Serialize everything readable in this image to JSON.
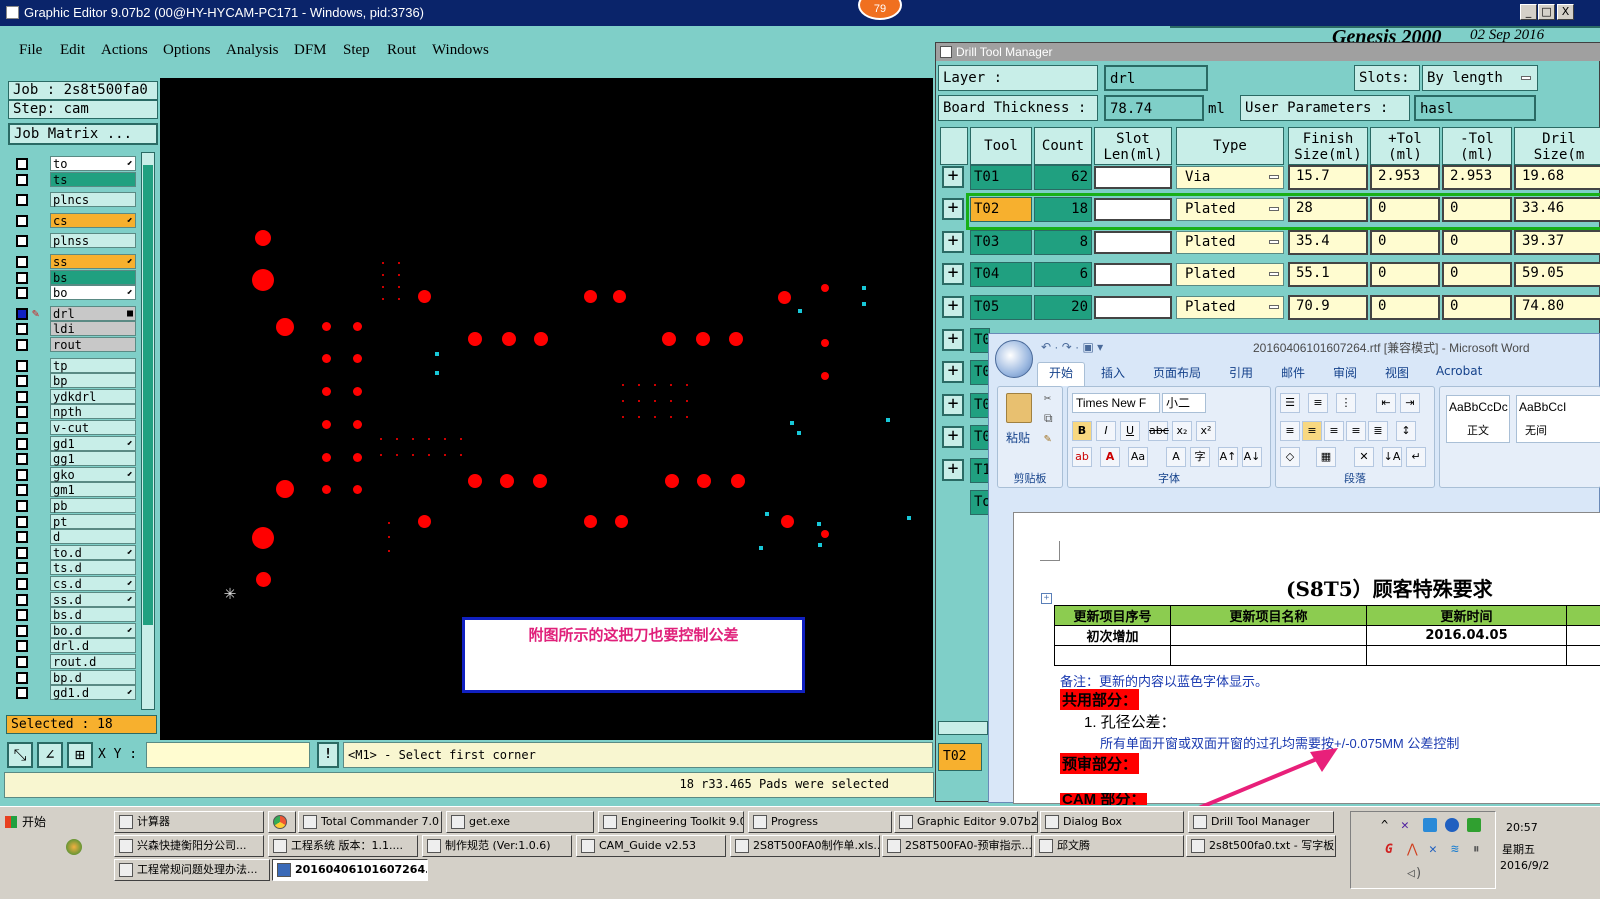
{
  "window": {
    "title": "Graphic Editor 9.07b2 (00@HY-HYCAM-PC171 - Windows, pid:3736)",
    "badge": "79",
    "btn_min": "_",
    "btn_max": "□",
    "btn_close": "X",
    "header_right": "Genesis 2000",
    "header_date": "02 Sep 2016"
  },
  "menu": [
    "File",
    "Edit",
    "Actions",
    "Options",
    "Analysis",
    "DFM",
    "Step",
    "Rout",
    "Windows"
  ],
  "left": {
    "job": "Job : 2s8t500fa0",
    "step": "Step: cam",
    "job_matrix": "Job Matrix ...",
    "selected": "Selected : 18",
    "layers": [
      {
        "name": "to",
        "style": "white",
        "arrow": "⬋"
      },
      {
        "name": "ts",
        "style": "green",
        "arrow": ""
      },
      {
        "name": "plncs",
        "style": "plain",
        "arrow": ""
      },
      {
        "name": "cs",
        "style": "orange",
        "arrow": "⬋"
      },
      {
        "name": "plnss",
        "style": "plain",
        "arrow": ""
      },
      {
        "name": "ss",
        "style": "orange",
        "arrow": "⬋"
      },
      {
        "name": "bs",
        "style": "green",
        "arrow": ""
      },
      {
        "name": "bo",
        "style": "white",
        "arrow": "⬋"
      },
      {
        "name": "drl",
        "style": "grey",
        "arrow": "■"
      },
      {
        "name": "ldi",
        "style": "grey",
        "arrow": ""
      },
      {
        "name": "rout",
        "style": "grey",
        "arrow": ""
      },
      {
        "name": "tp",
        "style": "plain",
        "arrow": ""
      },
      {
        "name": "bp",
        "style": "plain",
        "arrow": ""
      },
      {
        "name": "ydkdrl",
        "style": "plain",
        "arrow": ""
      },
      {
        "name": "npth",
        "style": "plain",
        "arrow": ""
      },
      {
        "name": "v-cut",
        "style": "plain",
        "arrow": ""
      },
      {
        "name": "gd1",
        "style": "plain",
        "arrow": "⬋"
      },
      {
        "name": "gg1",
        "style": "plain",
        "arrow": ""
      },
      {
        "name": "gko",
        "style": "plain",
        "arrow": "⬋"
      },
      {
        "name": "gm1",
        "style": "plain",
        "arrow": ""
      },
      {
        "name": "pb",
        "style": "plain",
        "arrow": ""
      },
      {
        "name": "pt",
        "style": "plain",
        "arrow": ""
      },
      {
        "name": "d",
        "style": "plain",
        "arrow": ""
      },
      {
        "name": "to.d",
        "style": "plain",
        "arrow": "⬋"
      },
      {
        "name": "ts.d",
        "style": "plain",
        "arrow": ""
      },
      {
        "name": "cs.d",
        "style": "plain",
        "arrow": "⬋"
      },
      {
        "name": "ss.d",
        "style": "plain",
        "arrow": "⬋"
      },
      {
        "name": "bs.d",
        "style": "plain",
        "arrow": ""
      },
      {
        "name": "bo.d",
        "style": "plain",
        "arrow": "⬋"
      },
      {
        "name": "drl.d",
        "style": "plain",
        "arrow": ""
      },
      {
        "name": "rout.d",
        "style": "plain",
        "arrow": ""
      },
      {
        "name": "bp.d",
        "style": "plain",
        "arrow": ""
      },
      {
        "name": "gd1.d",
        "style": "plain",
        "arrow": "⬋"
      }
    ]
  },
  "canvas": {
    "note": "附图所示的这把刀也要控制公差"
  },
  "bottom": {
    "xy_label": "X Y :",
    "xy_value": "",
    "prompt": "<M1> - Select first corner",
    "status": "18 r33.465 Pads were selected"
  },
  "dtm": {
    "title": "Drill Tool Manager",
    "layer_label": "Layer :",
    "layer_value": "drl",
    "slots_label": "Slots:",
    "slots_value": "By length",
    "thickness_label": "Board Thickness :",
    "thickness_value": "78.74",
    "thickness_unit": "ml",
    "user_params_label": "User Parameters :",
    "user_params_value": "hasl",
    "headers": [
      "Tool",
      "Count",
      "Slot Len(ml)",
      "Type",
      "Finish Size(ml)",
      "+Tol (ml)",
      "-Tol (ml)",
      "Dril Size(m"
    ],
    "rows": [
      {
        "tool": "T01",
        "count": "62",
        "type": "Via",
        "finish": "15.7",
        "ptol": "2.953",
        "ntol": "2.953",
        "drill": "19.68"
      },
      {
        "tool": "T02",
        "count": "18",
        "type": "Plated",
        "finish": "28",
        "ptol": "0",
        "ntol": "0",
        "drill": "33.46"
      },
      {
        "tool": "T03",
        "count": "8",
        "type": "Plated",
        "finish": "35.4",
        "ptol": "0",
        "ntol": "0",
        "drill": "39.37"
      },
      {
        "tool": "T04",
        "count": "6",
        "type": "Plated",
        "finish": "55.1",
        "ptol": "0",
        "ntol": "0",
        "drill": "59.05"
      },
      {
        "tool": "T05",
        "count": "20",
        "type": "Plated",
        "finish": "70.9",
        "ptol": "0",
        "ntol": "0",
        "drill": "74.80"
      }
    ],
    "partial_tools": [
      "T0",
      "T0",
      "T0",
      "T0",
      "T1",
      "To"
    ],
    "bottom_tool": "T02"
  },
  "word": {
    "title": "20160406101607264.rtf [兼容模式] - Microsoft Word",
    "tabs": [
      "开始",
      "插入",
      "页面布局",
      "引用",
      "邮件",
      "审阅",
      "视图",
      "Acrobat"
    ],
    "font_name": "Times New F",
    "font_size": "小二",
    "groups": {
      "clipboard": "剪贴板",
      "font": "字体",
      "paragraph": "段落"
    },
    "paste": "粘贴",
    "styles": [
      {
        "sample": "AaBbCcDc",
        "name": "正文"
      },
      {
        "sample": "AaBbCcI",
        "name": "无间"
      }
    ],
    "doc_title": "(S8T5）顾客特殊要求",
    "table_headers": [
      "更新项目序号",
      "更新项目名称",
      "更新时间"
    ],
    "table_row": [
      "初次增加",
      "",
      "2016.04.05"
    ],
    "note": "备注：更新的内容以蓝色字体显示。",
    "section1": "共用部分：",
    "item1": "1. 孔径公差：",
    "item1_text": "所有单面开窗或双面开窗的过孔均需要按+/-0.075MM 公差控制",
    "section2": "预审部分：",
    "section3": "CAM 部分："
  },
  "taskbar": {
    "start": "开始",
    "row1": [
      "计算器",
      "",
      "Total Commander 7.0 ...",
      "get.exe",
      "Engineering Toolkit 9.0...",
      "Progress",
      "Graphic Editor 9.07b2 ...",
      "Dialog Box",
      "Drill Tool Manager"
    ],
    "row2": [
      "兴森快捷衡阳分公司...",
      "工程系统  版本：1.1....",
      "制作规范 (Ver:1.0.6)",
      "CAM_Guide v2.53",
      "2S8T500FA0制作单.xls...",
      "2S8T500FA0-预审指示...",
      "邱文腾",
      "2s8t500fa0.txt - 写字板"
    ],
    "row3": [
      "工程常规问题处理办法...",
      "20160406101607264..."
    ],
    "time": "20:57",
    "weekday": "星期五",
    "date": "2016/9/2"
  }
}
